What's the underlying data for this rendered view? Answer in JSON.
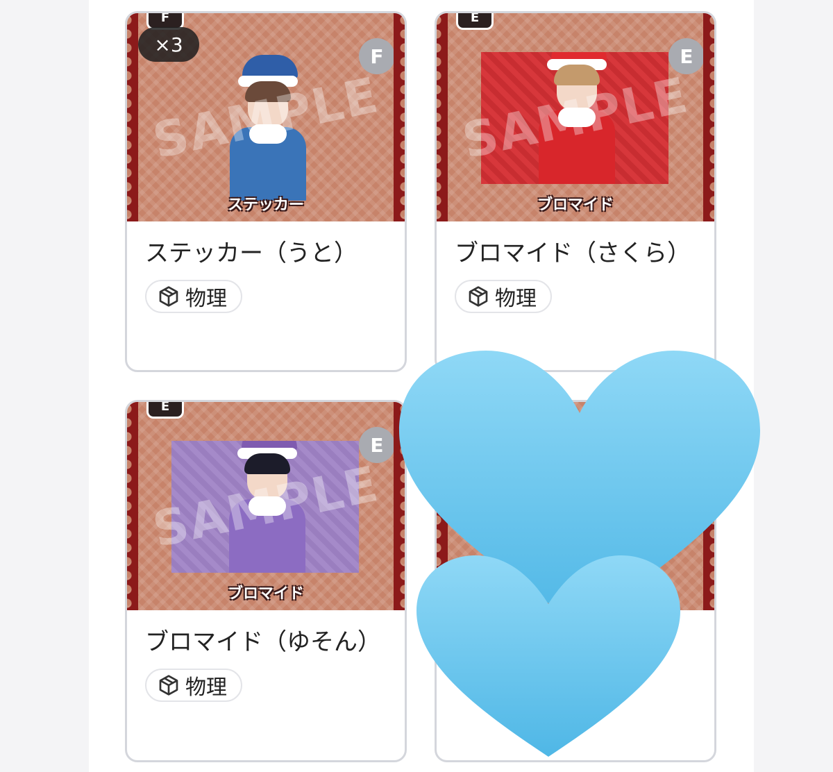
{
  "items": [
    {
      "title": "ステッカー（うと）",
      "rank": "F",
      "quantity": "×3",
      "type_label": "ステッカー",
      "watermark": "SAMPLE",
      "tag_label": "物理",
      "tag_icon": "package-icon",
      "medal": "F"
    },
    {
      "title": "ブロマイド（さくら）",
      "rank": "E",
      "type_label": "ブロマイド",
      "watermark": "SAMPLE",
      "tag_label": "物理",
      "tag_icon": "package-icon",
      "medal": "E"
    },
    {
      "title": "ブロマイド（ゆそん）",
      "rank": "E",
      "type_label": "ブロマイド",
      "watermark": "SAMPLE",
      "tag_label": "物理",
      "tag_icon": "package-icon",
      "medal": "E"
    }
  ],
  "colors": {
    "card_bg": "#c7836a",
    "scallop": "#8c1a1a",
    "heart": "#6ccaf0",
    "rank_badge": "#a9abb1"
  },
  "overlay": {
    "icon": "blue-heart-icon"
  }
}
